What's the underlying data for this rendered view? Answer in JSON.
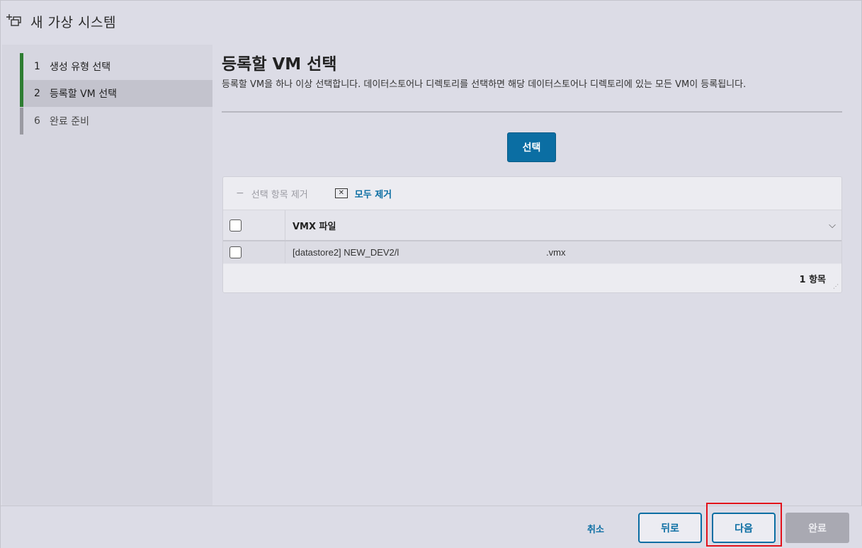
{
  "window": {
    "title": "새 가상 시스템",
    "icon": "add-vm-icon"
  },
  "wizard_steps": [
    {
      "number": "1",
      "label": "생성 유형 선택",
      "state": "completed"
    },
    {
      "number": "2",
      "label": "등록할 VM 선택",
      "state": "active"
    },
    {
      "number": "6",
      "label": "완료 준비",
      "state": "upcoming"
    }
  ],
  "main": {
    "title": "등록할 VM 선택",
    "description": "등록할 VM을 하나 이상 선택합니다. 데이터스토어나 디렉토리를 선택하면 해당 데이터스토어나 디렉토리에 있는 모든 VM이 등록됩니다.",
    "select_button": "선택"
  },
  "grid": {
    "toolbar": {
      "remove_selected": "선택 항목 제거",
      "remove_all": "모두 제거"
    },
    "column_header": "VMX 파일",
    "rows": [
      {
        "path": "[datastore2] NEW_DEV2/l",
        "ext": ".vmx"
      }
    ],
    "footer_count": "1 항목"
  },
  "footer": {
    "cancel": "취소",
    "back": "뒤로",
    "next": "다음",
    "finish": "완료"
  },
  "colors": {
    "accent": "#0b6ea3",
    "step_complete": "#2e7d32",
    "highlight": "#e2111b"
  }
}
